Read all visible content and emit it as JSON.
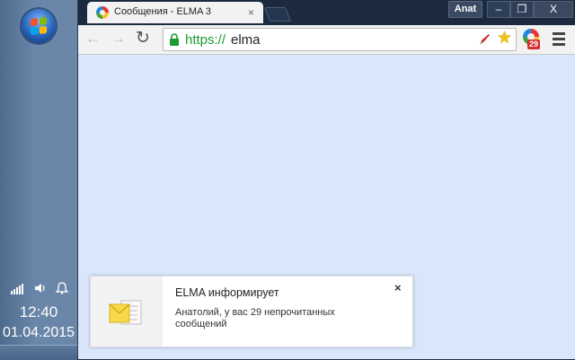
{
  "taskbar": {
    "clock_time": "12:40",
    "clock_date": "01.04.2015"
  },
  "browser": {
    "tab_title": "Сообщения - ELMA 3",
    "tab_close": "×",
    "profile_name": "Anat",
    "min_glyph": "–",
    "max_glyph": "❐",
    "close_glyph": "X",
    "back_glyph": "←",
    "forward_glyph": "→",
    "reload_glyph": "↻",
    "url_scheme": "https://",
    "url_host": "elma",
    "star_glyph": "★",
    "extension_badge": "29"
  },
  "notification": {
    "title": "ELMA информирует",
    "body": "Анатолий, у вас 29 непрочитанных сообщений",
    "close_glyph": "×"
  },
  "colors": {
    "page_background": "#d9e6fb",
    "url_scheme": "#1a9c2f",
    "badge": "#d32f2f"
  }
}
